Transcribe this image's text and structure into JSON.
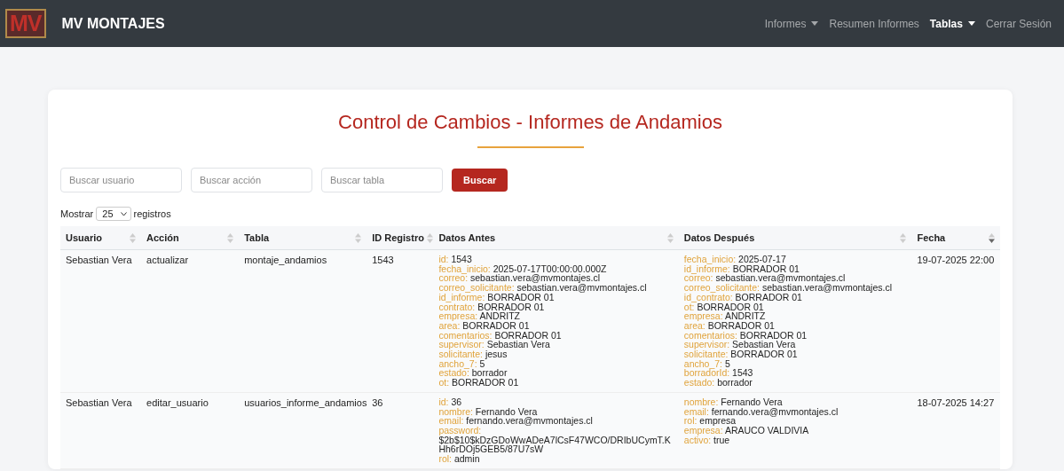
{
  "navbar": {
    "logo": "MV",
    "brand": "MV MONTAJES",
    "items": [
      {
        "label": "Informes",
        "dropdown": true,
        "selected": false
      },
      {
        "label": "Resumen Informes",
        "dropdown": false,
        "selected": false
      },
      {
        "label": "Tablas",
        "dropdown": true,
        "selected": true
      },
      {
        "label": "Cerrar Sesión",
        "dropdown": false,
        "selected": false
      }
    ]
  },
  "title": "Control de Cambios - Informes de Andamios",
  "filters": [
    {
      "placeholder": "Buscar usuario"
    },
    {
      "placeholder": "Buscar acción"
    },
    {
      "placeholder": "Buscar tabla"
    }
  ],
  "search_button": "Buscar",
  "page_length": {
    "before": "Mostrar",
    "value": "25",
    "after": "registros"
  },
  "table": {
    "columns": [
      {
        "label": "Usuario",
        "sorted_desc": false
      },
      {
        "label": "Acción",
        "sorted_desc": false
      },
      {
        "label": "Tabla",
        "sorted_desc": false
      },
      {
        "label": "ID Registro",
        "sorted_desc": false
      },
      {
        "label": "Datos Antes",
        "sorted_desc": false
      },
      {
        "label": "Datos Después",
        "sorted_desc": false
      },
      {
        "label": "Fecha",
        "sorted_desc": true
      }
    ],
    "rows": [
      {
        "usuario": "Sebastian Vera",
        "accion": "actualizar",
        "tabla": "montaje_andamios",
        "id_registro": "1543",
        "datos_antes": [
          [
            "id:",
            "1543"
          ],
          [
            "fecha_inicio:",
            "2025-07-17T00:00:00.000Z"
          ],
          [
            "correo:",
            "sebastian.vera@mvmontajes.cl"
          ],
          [
            "correo_solicitante:",
            "sebastian.vera@mvmontajes.cl"
          ],
          [
            "id_informe:",
            "BORRADOR 01"
          ],
          [
            "contrato:",
            "BORRADOR 01"
          ],
          [
            "empresa:",
            "ANDRITZ"
          ],
          [
            "area:",
            "BORRADOR 01"
          ],
          [
            "comentarios:",
            "BORRADOR 01"
          ],
          [
            "supervisor:",
            "Sebastian Vera"
          ],
          [
            "solicitante:",
            "jesus"
          ],
          [
            "ancho_7:",
            "5"
          ],
          [
            "estado:",
            "borrador"
          ],
          [
            "ot:",
            "BORRADOR 01"
          ]
        ],
        "datos_despues": [
          [
            "fecha_inicio:",
            "2025-07-17"
          ],
          [
            "id_informe:",
            "BORRADOR 01"
          ],
          [
            "correo:",
            "sebastian.vera@mvmontajes.cl"
          ],
          [
            "correo_solicitante:",
            "sebastian.vera@mvmontajes.cl"
          ],
          [
            "id_contrato:",
            "BORRADOR 01"
          ],
          [
            "ot:",
            "BORRADOR 01"
          ],
          [
            "empresa:",
            "ANDRITZ"
          ],
          [
            "area:",
            "BORRADOR 01"
          ],
          [
            "comentarios:",
            "BORRADOR 01"
          ],
          [
            "supervisor:",
            "Sebastian Vera"
          ],
          [
            "solicitante:",
            "BORRADOR 01"
          ],
          [
            "ancho_7:",
            "5"
          ],
          [
            "borradorId:",
            "1543"
          ],
          [
            "estado:",
            "borrador"
          ]
        ],
        "fecha": "19-07-2025 22:00"
      },
      {
        "usuario": "Sebastian Vera",
        "accion": "editar_usuario",
        "tabla": "usuarios_informe_andamios",
        "id_registro": "36",
        "datos_antes": [
          [
            "id:",
            "36"
          ],
          [
            "nombre:",
            "Fernando Vera"
          ],
          [
            "email:",
            "fernando.vera@mvmontajes.cl"
          ],
          [
            "password:",
            "$2b$10$kDzGDoWwADeA7lCsF47WCO/DRIbUCymT.KHh6rDOj5GEB5/87U7sW"
          ],
          [
            "rol:",
            "admin"
          ]
        ],
        "datos_despues": [
          [
            "nombre:",
            "Fernando Vera"
          ],
          [
            "email:",
            "fernando.vera@mvmontajes.cl"
          ],
          [
            "rol:",
            "empresa"
          ],
          [
            "empresa:",
            "ARAUCO VALDIVIA"
          ],
          [
            "activo:",
            "true"
          ]
        ],
        "fecha": "18-07-2025 14:27"
      }
    ]
  }
}
